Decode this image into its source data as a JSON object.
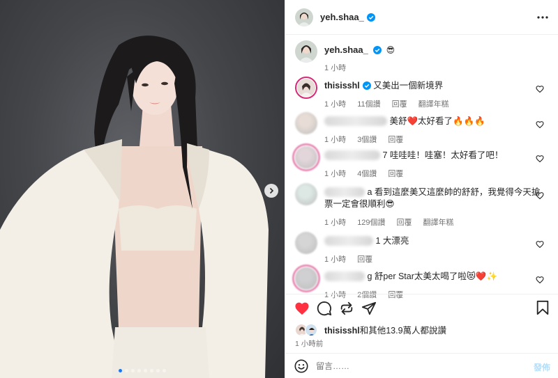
{
  "post": {
    "username": "yeh.shaa_",
    "more_icon": "more-horizontal-icon",
    "caption_emoji": "😎",
    "caption_time": "1 小時",
    "carousel_dots": 8,
    "carousel_active": 1
  },
  "comments": [
    {
      "user": "thisisshl",
      "verified": true,
      "text": "又美出一個新境界",
      "time": "1 小時",
      "likes": "11個讚",
      "reply": "回覆",
      "translate": "翻譯年糕"
    },
    {
      "user": "",
      "verified": false,
      "text": "美舒❤️太好看了🔥🔥🔥",
      "time": "1 小時",
      "likes": "3個讚",
      "reply": "回覆",
      "translate": ""
    },
    {
      "user": "",
      "verified": false,
      "text": "7 哇哇哇！哇塞！太好看了吧！",
      "time": "1 小時",
      "likes": "4個讚",
      "reply": "回覆",
      "translate": ""
    },
    {
      "user": "",
      "verified": false,
      "text": "a 看到這麼美又這麼帥的舒舒，我覺得今天搶票一定會很順利😎",
      "time": "1 小時",
      "likes": "129個讚",
      "reply": "回覆",
      "translate": "翻譯年糕"
    },
    {
      "user": "",
      "verified": false,
      "text": "1 大漂亮",
      "time": "1 小時",
      "likes": "",
      "reply": "回覆",
      "translate": ""
    },
    {
      "user": "",
      "verified": false,
      "text": "g 舒per Star太美太喝了啦😻❤️✨",
      "time": "1 小時",
      "likes": "2個讚",
      "reply": "回覆",
      "translate": ""
    }
  ],
  "actions": {
    "like_icon": "heart-filled-icon",
    "comment_icon": "comment-icon",
    "repost_icon": "repost-icon",
    "share_icon": "send-icon",
    "save_icon": "bookmark-icon",
    "like_color": "#ff3040"
  },
  "likes": {
    "user": "thisisshl",
    "rest": "和其他13.9萬人都說讚"
  },
  "post_time": "1 小時前",
  "composer": {
    "placeholder": "留言……",
    "post_label": "發佈"
  },
  "colors": {
    "verified": "#0095f6",
    "accent": "#1877f2",
    "post_disabled": "#b2dffc"
  }
}
